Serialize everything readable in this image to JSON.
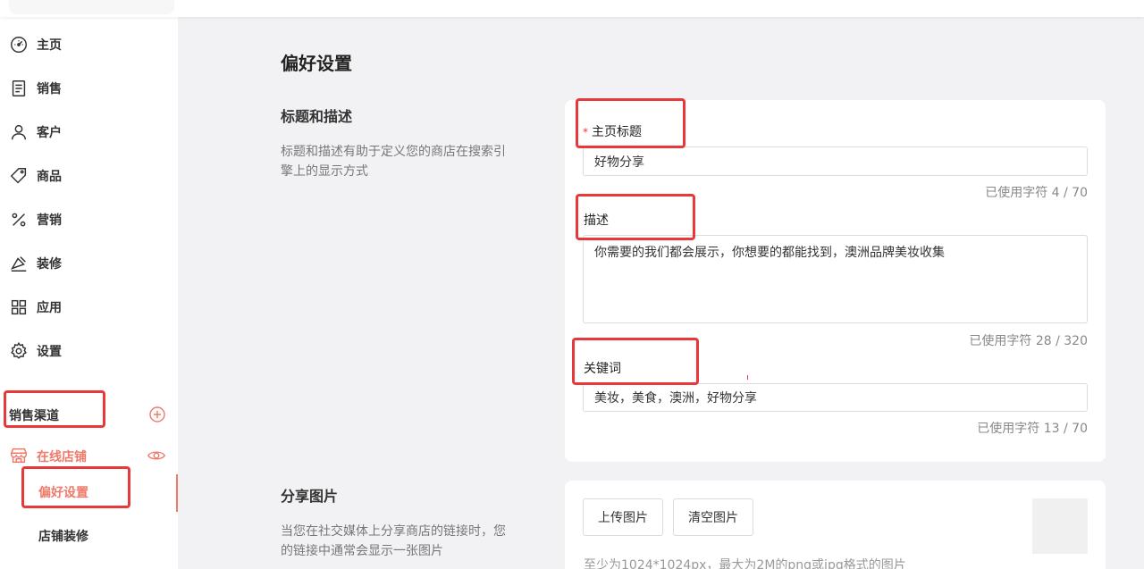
{
  "sidebar": {
    "items": [
      {
        "label": "主页",
        "icon": "dashboard-icon"
      },
      {
        "label": "销售",
        "icon": "receipt-icon"
      },
      {
        "label": "客户",
        "icon": "user-icon"
      },
      {
        "label": "商品",
        "icon": "tag-icon"
      },
      {
        "label": "营销",
        "icon": "percent-icon"
      },
      {
        "label": "装修",
        "icon": "paint-icon"
      },
      {
        "label": "应用",
        "icon": "apps-icon"
      },
      {
        "label": "设置",
        "icon": "gear-icon"
      }
    ],
    "channel_label": "销售渠道",
    "store_label": "在线店铺",
    "sub_items": [
      {
        "label": "偏好设置",
        "active": true
      },
      {
        "label": "店铺装修",
        "active": false
      }
    ],
    "accent_color": "#f07a6a"
  },
  "main": {
    "page_title": "偏好设置",
    "sections": {
      "seo": {
        "title": "标题和描述",
        "description": "标题和描述有助于定义您的商店在搜索引擎上的显示方式",
        "fields": {
          "home_title": {
            "required_mark": "*",
            "label": "主页标题",
            "value": "好物分享",
            "counter": "已使用字符 4 / 70"
          },
          "description": {
            "label": "描述",
            "value": "你需要的我们都会展示，你想要的都能找到，澳洲品牌美妆收集",
            "counter": "已使用字符 28 / 320"
          },
          "keywords": {
            "label": "关键词",
            "value": "美妆，美食，澳洲，好物分享",
            "counter": "已使用字符 13 / 70"
          }
        }
      },
      "share_image": {
        "title": "分享图片",
        "description": "当您在社交媒体上分享商店的链接时，您的链接中通常会显示一张图片",
        "upload_label": "上传图片",
        "clear_label": "清空图片",
        "hint": "至少为1024*1024px，最大为2M的png或jpg格式的图片"
      }
    }
  },
  "highlight_color": "#e8393a"
}
